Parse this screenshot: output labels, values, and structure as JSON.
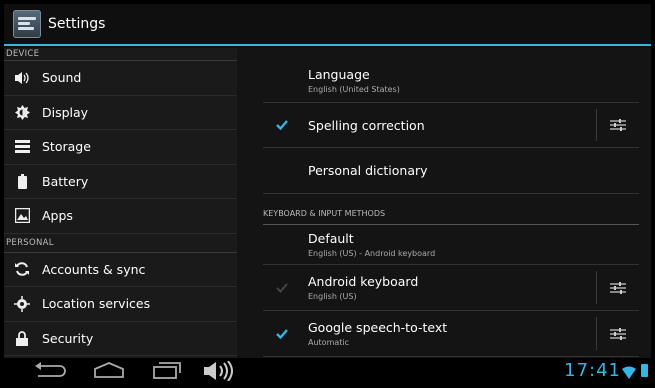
{
  "action_bar": {
    "title": "Settings"
  },
  "left_pane": {
    "device_header": "DEVICE",
    "device_items": [
      {
        "label": "Sound",
        "icon": "speaker-icon"
      },
      {
        "label": "Display",
        "icon": "brightness-icon"
      },
      {
        "label": "Storage",
        "icon": "storage-icon"
      },
      {
        "label": "Battery",
        "icon": "battery-icon"
      },
      {
        "label": "Apps",
        "icon": "apps-icon"
      }
    ],
    "personal_header": "PERSONAL",
    "personal_items": [
      {
        "label": "Accounts & sync",
        "icon": "sync-icon"
      },
      {
        "label": "Location services",
        "icon": "location-icon"
      },
      {
        "label": "Security",
        "icon": "lock-icon"
      }
    ]
  },
  "right_pane": {
    "language": {
      "title": "Language",
      "summary": "English (United States)"
    },
    "spelling": {
      "title": "Spelling correction",
      "checked": true
    },
    "dictionary": {
      "title": "Personal dictionary"
    },
    "keyboard_header": "KEYBOARD & INPUT METHODS",
    "default": {
      "title": "Default",
      "summary": "English (US) - Android keyboard"
    },
    "android_keyboard": {
      "title": "Android keyboard",
      "summary": "English (US)",
      "checked": true,
      "enabled": false
    },
    "google_speech": {
      "title": "Google speech-to-text",
      "summary": "Automatic",
      "checked": true
    }
  },
  "status": {
    "time": "17:41"
  },
  "colors": {
    "accent": "#33b5e5"
  }
}
